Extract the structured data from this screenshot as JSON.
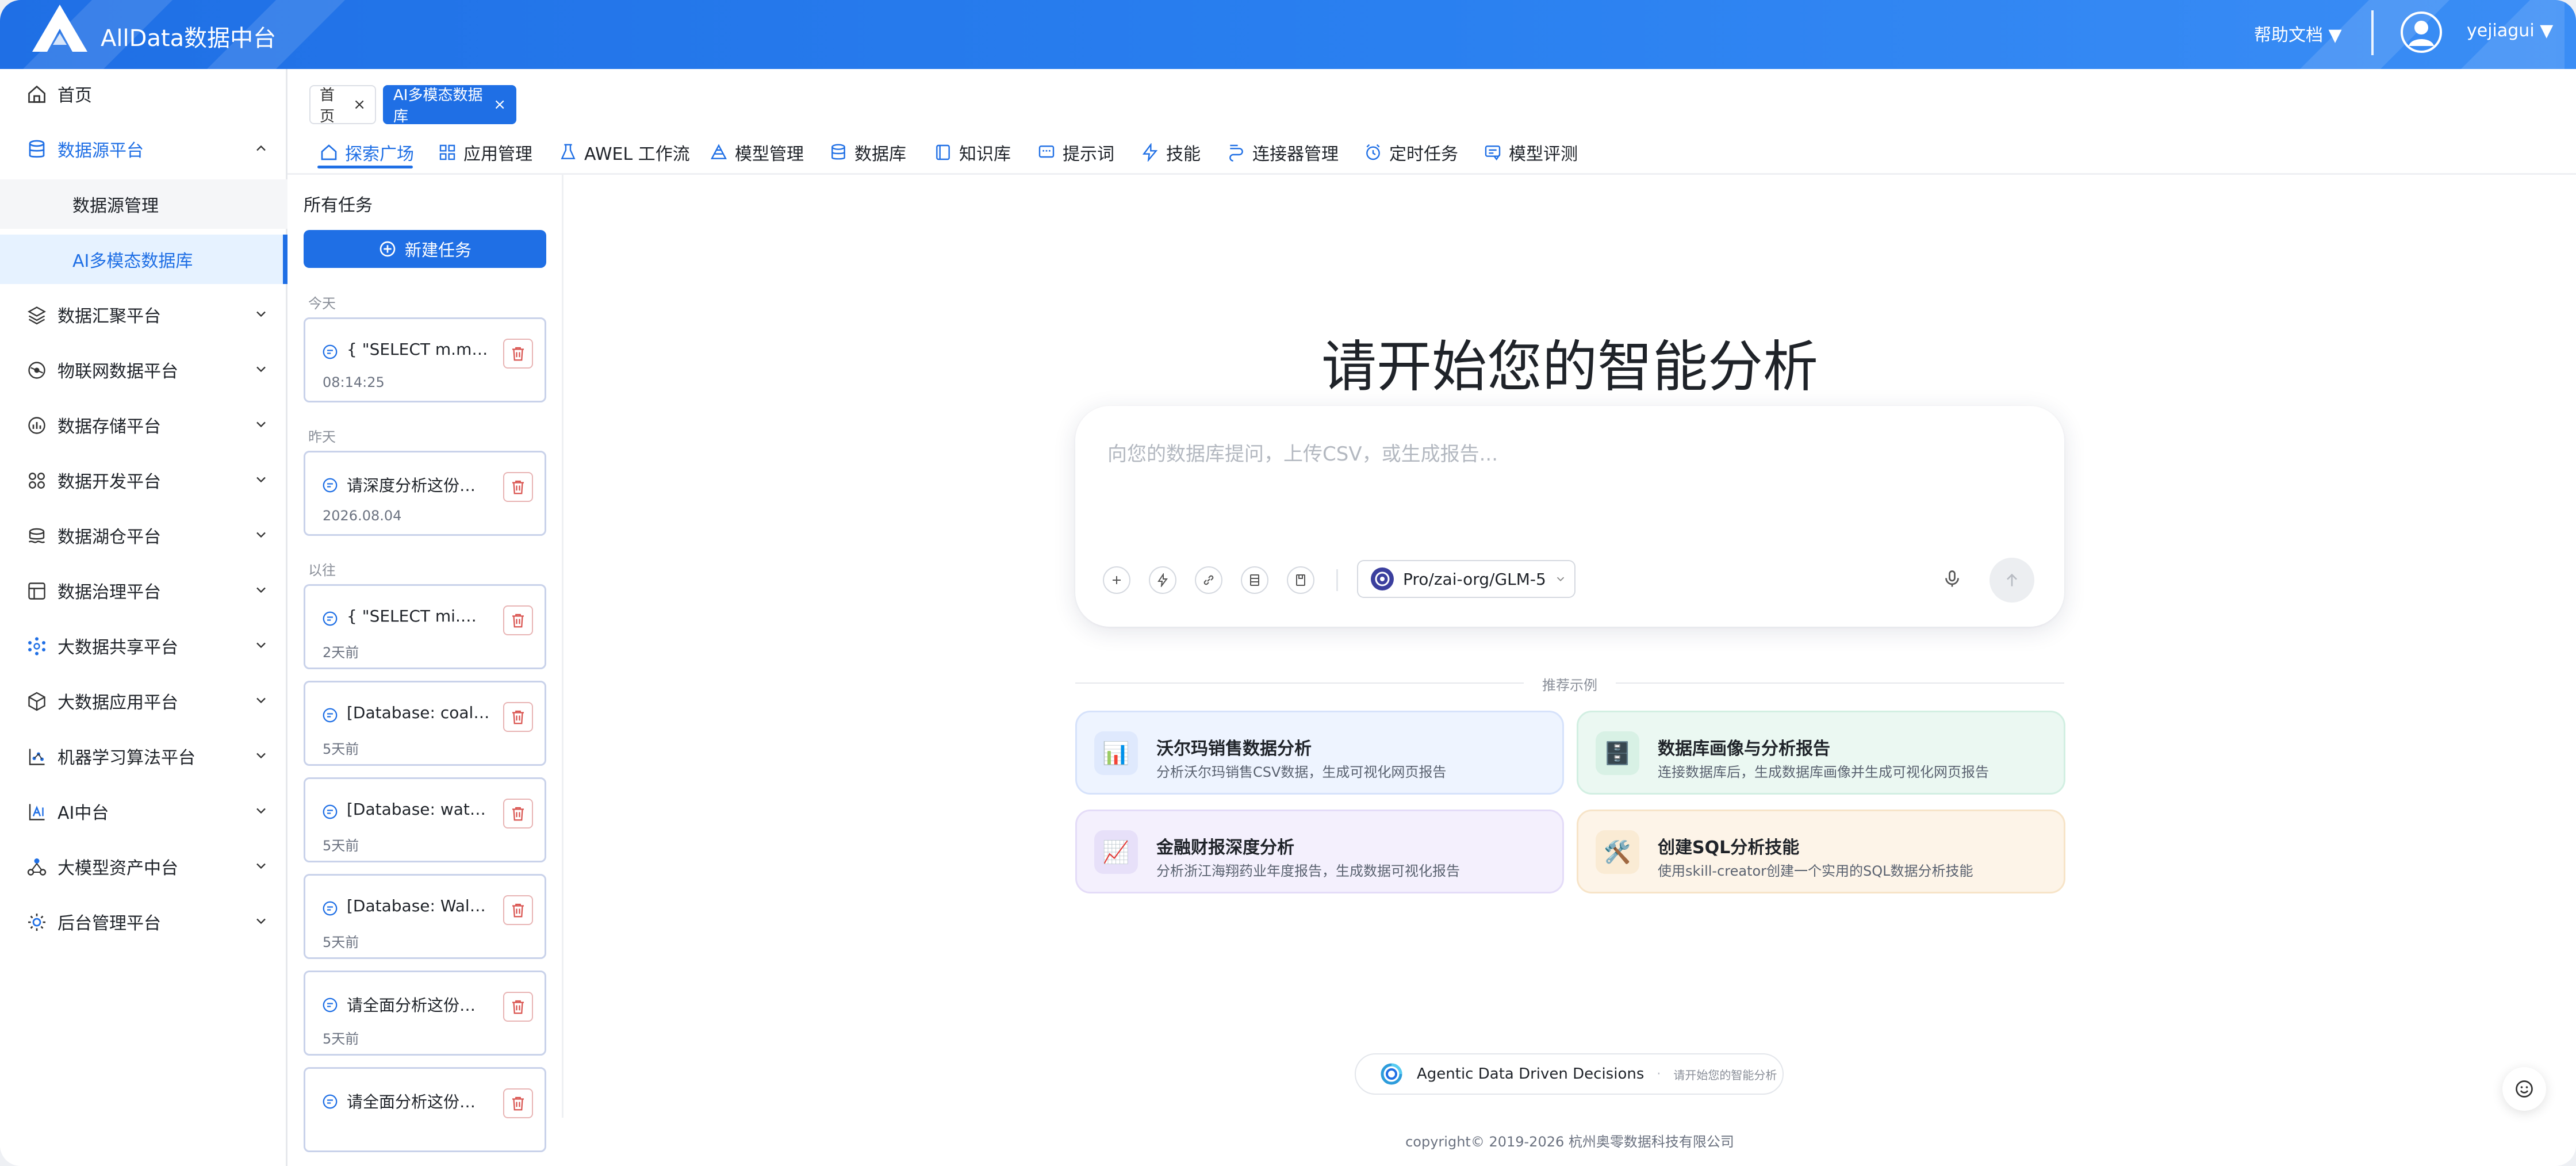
{
  "header": {
    "app_title": "AllData数据中台",
    "help_label": "帮助文档 ▼",
    "user_label": "yejiagui ▼"
  },
  "sidebar": {
    "items": [
      {
        "label": "首页",
        "icon": "home-icon"
      },
      {
        "label": "数据源平台",
        "icon": "database-icon",
        "expanded": true
      },
      {
        "label": "数据源管理"
      },
      {
        "label": "AI多模态数据库",
        "active": true
      },
      {
        "label": "数据汇聚平台",
        "icon": "layers-icon"
      },
      {
        "label": "物联网数据平台",
        "icon": "iot-icon"
      },
      {
        "label": "数据存储平台",
        "icon": "storage-icon"
      },
      {
        "label": "数据开发平台",
        "icon": "grid-icon"
      },
      {
        "label": "数据湖仓平台",
        "icon": "lake-icon"
      },
      {
        "label": "数据治理平台",
        "icon": "governance-icon"
      },
      {
        "label": "大数据共享平台",
        "icon": "share-icon"
      },
      {
        "label": "大数据应用平台",
        "icon": "cube-icon"
      },
      {
        "label": "机器学习算法平台",
        "icon": "ml-icon"
      },
      {
        "label": "AI中台",
        "icon": "ai-icon"
      },
      {
        "label": "大模型资产中台",
        "icon": "model-asset-icon"
      },
      {
        "label": "后台管理平台",
        "icon": "admin-icon"
      }
    ]
  },
  "page_tabs": [
    {
      "label": "首页",
      "close": "×"
    },
    {
      "label": "AI多模态数据库",
      "close": "×",
      "active": true
    }
  ],
  "menu": {
    "items": [
      {
        "label": "探索广场",
        "active": true
      },
      {
        "label": "应用管理"
      },
      {
        "label": "AWEL 工作流"
      },
      {
        "label": "模型管理"
      },
      {
        "label": "数据库"
      },
      {
        "label": "知识库"
      },
      {
        "label": "提示词"
      },
      {
        "label": "技能"
      },
      {
        "label": "连接器管理"
      },
      {
        "label": "定时任务"
      },
      {
        "label": "模型评测"
      }
    ]
  },
  "tasks": {
    "title": "所有任务",
    "new_task_label": "新建任务",
    "groups": {
      "today": "今天",
      "yesterday": "昨天",
      "earlier": "以往"
    },
    "items": [
      {
        "title": "{ \"SELECT m.mine...",
        "time": "08:14:25"
      },
      {
        "title": "请深度分析这份浙...",
        "time": "2026.08.04"
      },
      {
        "title": "{ \"SELECT mi.min...",
        "time": "2天前"
      },
      {
        "title": "[Database: coal_...",
        "time": "5天前"
      },
      {
        "title": "[Database: water_...",
        "time": "5天前"
      },
      {
        "title": "[Database: Walma...",
        "time": "5天前"
      },
      {
        "title": "请全面分析这份沃...",
        "time": "5天前"
      },
      {
        "title": "请全面分析这份沃...",
        "time": ""
      }
    ]
  },
  "main": {
    "hero_title": "请开始您的智能分析",
    "input_placeholder": "向您的数据库提问，上传CSV，或生成报告...",
    "model_label": "Pro/zai-org/GLM-5",
    "suggest_label": "推荐示例",
    "suggestions": [
      {
        "title": "沃尔玛销售数据分析",
        "desc": "分析沃尔玛销售CSV数据，生成可视化网页报告",
        "icon": "📊",
        "bg": "#eef4ff",
        "border": "#d6e2fb",
        "icon_bg": "#dfe9fd"
      },
      {
        "title": "数据库画像与分析报告",
        "desc": "连接数据库后，生成数据库画像并生成可视化网页报告",
        "icon": "🗄️",
        "bg": "#ebf8f2",
        "border": "#d2efe2",
        "icon_bg": "#d8f1e5"
      },
      {
        "title": "金融财报深度分析",
        "desc": "分析浙江海翔药业年度报告，生成数据可视化报告",
        "icon": "📈",
        "bg": "#f4f0fd",
        "border": "#e4dcf8",
        "icon_bg": "#e7e0f9"
      },
      {
        "title": "创建SQL分析技能",
        "desc": "使用skill-creator创建一个实用的SQL数据分析技能",
        "icon": "🛠️",
        "bg": "#fdf4e8",
        "border": "#f7e4c8",
        "icon_bg": "#faebd4"
      }
    ],
    "agentic_text": "Agentic Data Driven Decisions",
    "agentic_dot": "·",
    "agentic_sub": "请开始您的智能分析"
  },
  "footer": {
    "copyright": "copyright© 2019-2026 杭州奥零数据科技有限公司"
  },
  "colors": {
    "primary": "#1f6fe5",
    "header_gradient_end": "#3a8df5",
    "delete_red": "#d9534f"
  }
}
